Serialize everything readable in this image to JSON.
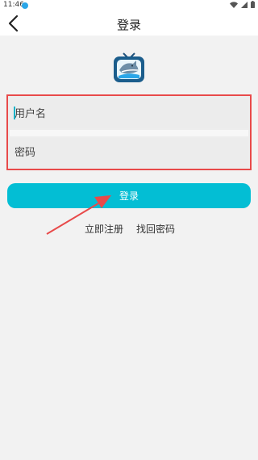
{
  "status_bar": {
    "time": "11:46",
    "badge": "●"
  },
  "header": {
    "title": "登录",
    "back_icon": "chevron-left-icon"
  },
  "logo": {
    "icon": "shark-tv-logo-icon"
  },
  "form": {
    "username_placeholder": "用户名",
    "password_placeholder": "密码",
    "highlight_color": "#e84a4a"
  },
  "login_button": {
    "label": "登录",
    "color": "#03bed4"
  },
  "links": {
    "register": "立即注册",
    "forgot_password": "找回密码"
  },
  "annotation": {
    "arrow_color": "#e84a4a"
  }
}
